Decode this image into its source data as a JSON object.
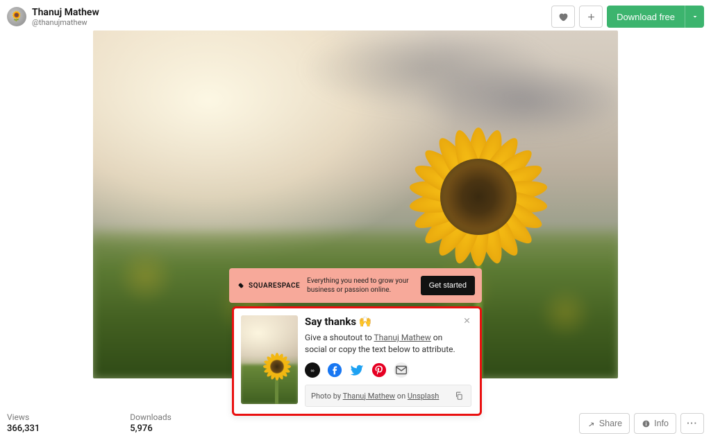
{
  "header": {
    "author_name": "Thanuj Mathew",
    "author_handle": "@thanujmathew",
    "download_label": "Download free"
  },
  "ad": {
    "brand": "SQUARESPACE",
    "text": "Everything you need to grow your business or passion online.",
    "cta": "Get started"
  },
  "thanks": {
    "title": "Say thanks",
    "emoji": "🙌",
    "text_pre": "Give a shoutout to ",
    "author": "Thanuj Mathew",
    "text_post": " on social or copy the text below to attribute.",
    "attr_pre": "Photo by ",
    "attr_author": "Thanuj Mathew",
    "attr_mid": " on ",
    "attr_site": "Unsplash"
  },
  "stats": {
    "views_label": "Views",
    "views_value": "366,331",
    "downloads_label": "Downloads",
    "downloads_value": "5,976"
  },
  "footer": {
    "share": "Share",
    "info": "Info",
    "more": "···"
  }
}
